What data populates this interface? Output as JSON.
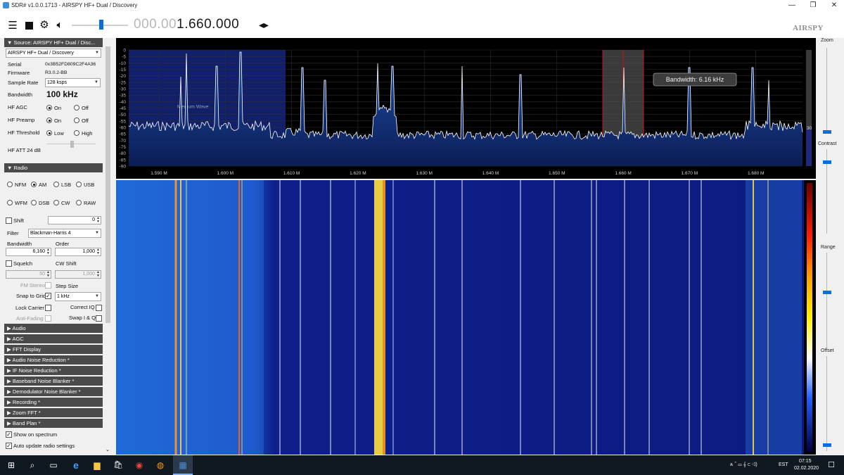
{
  "window": {
    "title": "SDR# v1.0.0.1713 - AIRSPY HF+ Dual / Discovery",
    "minimize": "—",
    "maximize": "❐",
    "close": "✕"
  },
  "toolbar": {
    "freq_dim": "000.00",
    "freq_hi": "1.660.000",
    "logo": "AIRSPY"
  },
  "source": {
    "header": "Source: AIRSPY HF+ Dual / Disc...",
    "device": "AIRSPY HF+ Dual / Discovery",
    "serial_label": "Serial",
    "serial": "0x3B52FD809C2F4A36",
    "firmware_label": "Firmware",
    "firmware": "R3.0.2-BB",
    "sample_rate_label": "Sample Rate",
    "sample_rate": "128 ksps",
    "bandwidth_label": "Bandwidth",
    "bandwidth": "100 kHz",
    "hf_agc_label": "HF AGC",
    "hf_preamp_label": "HF Preamp",
    "hf_threshold_label": "HF Threshold",
    "on": "On",
    "off": "Off",
    "low": "Low",
    "high": "High",
    "hf_att_label": "HF ATT 24 dB"
  },
  "radio": {
    "header": "Radio",
    "modes_row1": [
      "NFM",
      "AM",
      "LSB",
      "USB"
    ],
    "modes_row2": [
      "WFM",
      "DSB",
      "CW",
      "RAW"
    ],
    "selected_mode": "AM",
    "shift_label": "Shift",
    "shift_value": "0",
    "filter_label": "Filter",
    "filter_value": "Blackman-Harris 4",
    "bandwidth_label": "Bandwidth",
    "order_label": "Order",
    "bandwidth_value": "6,160",
    "order_value": "1,000",
    "squelch_label": "Squelch",
    "cw_shift_label": "CW Shift",
    "squelch_value": "50",
    "cw_shift_value": "1,000",
    "fm_stereo_label": "FM Stereo",
    "step_size_label": "Step Size",
    "snap_label": "Snap to Grid",
    "step_value": "1 kHz",
    "lock_carrier_label": "Lock Carrier",
    "correct_iq_label": "Correct IQ",
    "anti_fading_label": "Anti-Fading",
    "swap_iq_label": "Swap I & Q"
  },
  "sections": [
    "Audio",
    "AGC",
    "FFT Display",
    "Audio Noise Reduction *",
    "IF Noise Reduction *",
    "Baseband Noise Blanker *",
    "Demodulator Noise Blanker *",
    "Recording *",
    "Zoom FFT *",
    "Band Plan *"
  ],
  "bottom_options": {
    "show_on_spectrum": "Show on spectrum",
    "auto_update": "Auto update radio settings"
  },
  "spectrum": {
    "db_labels": [
      "0",
      "-5",
      "-10",
      "-15",
      "-20",
      "-25",
      "-30",
      "-35",
      "-40",
      "-45",
      "-50",
      "-55",
      "-60",
      "-65",
      "-70",
      "-75",
      "-80",
      "-85",
      "-90"
    ],
    "freq_labels": [
      "1.590 M",
      "1.600 M",
      "1.610 M",
      "1.620 M",
      "1.630 M",
      "1.640 M",
      "1.650 M",
      "1.660 M",
      "1.670 M",
      "1.680 M"
    ],
    "bandplan_label": "Medium Wave",
    "tooltip": "Bandwidth: 6.16 kHz",
    "scale_value": "30",
    "colors": {
      "trace": "#ffffff",
      "fill_top": "#1f4fa8",
      "fill_bottom": "#0b1d55",
      "band": "#12206a",
      "filter": "#4d4d4d",
      "center": "#d01010"
    }
  },
  "right_panel": {
    "zoom": "Zoom",
    "contrast": "Contrast",
    "range": "Range",
    "offset": "Offset"
  },
  "taskbar": {
    "start_icon": "⊞",
    "search_icon": "⌕",
    "taskview_icon": "▭",
    "edge_icon": "e",
    "explorer_icon": "▆",
    "store_icon": "🛍",
    "chrome_icon": "◉",
    "app5_icon": "◍",
    "sdr_icon": "▦",
    "language": "EST",
    "time": "07:15",
    "date": "02.02.2020",
    "tray_icons": "ጰ ⌃ ▭ 𝄞 ⊂ ◁)",
    "notification_icon": "☐"
  }
}
